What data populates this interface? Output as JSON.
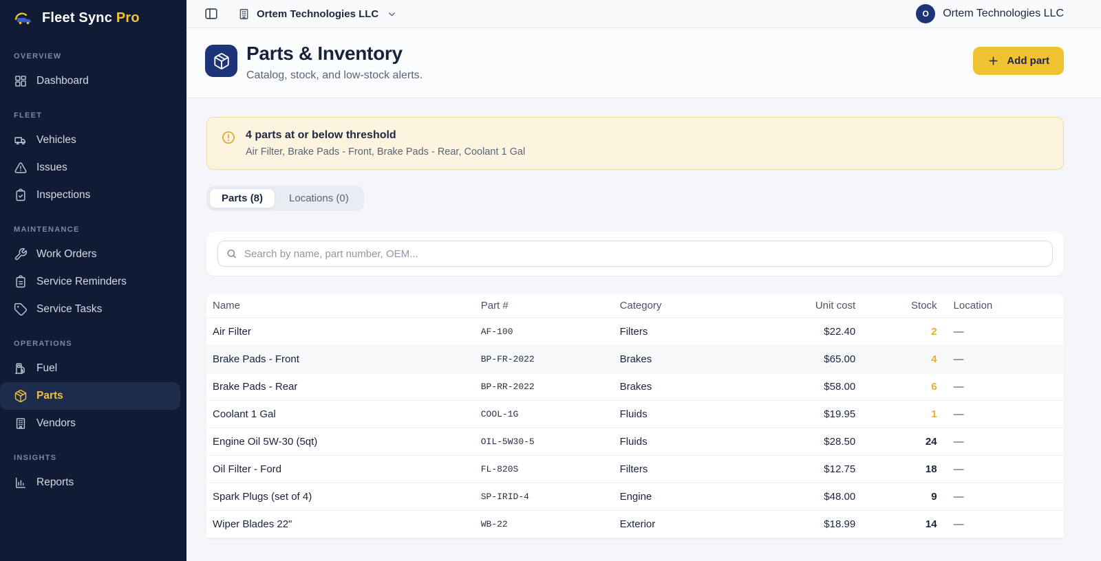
{
  "brand": {
    "name": "Fleet Sync",
    "suffix": "Pro"
  },
  "topbar": {
    "org_name": "Ortem Technologies LLC",
    "avatar_initial": "O",
    "account_name": "Ortem Technologies LLC"
  },
  "sidebar": {
    "sections": [
      {
        "label": "OVERVIEW",
        "items": [
          {
            "label": "Dashboard",
            "icon": "dashboard-icon",
            "active": false
          }
        ]
      },
      {
        "label": "FLEET",
        "items": [
          {
            "label": "Vehicles",
            "icon": "truck-icon",
            "active": false
          },
          {
            "label": "Issues",
            "icon": "warning-triangle-icon",
            "active": false
          },
          {
            "label": "Inspections",
            "icon": "clipboard-check-icon",
            "active": false
          }
        ]
      },
      {
        "label": "MAINTENANCE",
        "items": [
          {
            "label": "Work Orders",
            "icon": "wrench-icon",
            "active": false
          },
          {
            "label": "Service Reminders",
            "icon": "clipboard-list-icon",
            "active": false
          },
          {
            "label": "Service Tasks",
            "icon": "tag-icon",
            "active": false
          }
        ]
      },
      {
        "label": "OPERATIONS",
        "items": [
          {
            "label": "Fuel",
            "icon": "fuel-pump-icon",
            "active": false
          },
          {
            "label": "Parts",
            "icon": "package-icon",
            "active": true
          },
          {
            "label": "Vendors",
            "icon": "building-icon",
            "active": false
          }
        ]
      },
      {
        "label": "INSIGHTS",
        "items": [
          {
            "label": "Reports",
            "icon": "bar-chart-icon",
            "active": false
          }
        ]
      }
    ]
  },
  "page": {
    "title": "Parts & Inventory",
    "subtitle": "Catalog, stock, and low-stock alerts.",
    "add_button_label": "Add part",
    "icon": "package-icon"
  },
  "alert": {
    "icon": "alert-circle-icon",
    "title": "4 parts at or below threshold",
    "detail": "Air Filter, Brake Pads - Front, Brake Pads - Rear, Coolant 1 Gal"
  },
  "tabs": [
    {
      "label": "Parts (8)",
      "active": true
    },
    {
      "label": "Locations (0)",
      "active": false
    }
  ],
  "search": {
    "placeholder": "Search by name, part number, OEM...",
    "value": "",
    "icon": "search-icon"
  },
  "table": {
    "columns": [
      "Name",
      "Part #",
      "Category",
      "Unit cost",
      "Stock",
      "Location"
    ],
    "rows": [
      {
        "name": "Air Filter",
        "part_number": "AF-100",
        "category": "Filters",
        "unit_cost": "$22.40",
        "stock": "2",
        "low_stock": true,
        "location": "—",
        "highlight": false
      },
      {
        "name": "Brake Pads - Front",
        "part_number": "BP-FR-2022",
        "category": "Brakes",
        "unit_cost": "$65.00",
        "stock": "4",
        "low_stock": true,
        "location": "—",
        "highlight": true
      },
      {
        "name": "Brake Pads - Rear",
        "part_number": "BP-RR-2022",
        "category": "Brakes",
        "unit_cost": "$58.00",
        "stock": "6",
        "low_stock": true,
        "location": "—",
        "highlight": false
      },
      {
        "name": "Coolant 1 Gal",
        "part_number": "COOL-1G",
        "category": "Fluids",
        "unit_cost": "$19.95",
        "stock": "1",
        "low_stock": true,
        "location": "—",
        "highlight": false
      },
      {
        "name": "Engine Oil 5W-30 (5qt)",
        "part_number": "OIL-5W30-5",
        "category": "Fluids",
        "unit_cost": "$28.50",
        "stock": "24",
        "low_stock": false,
        "location": "—",
        "highlight": false
      },
      {
        "name": "Oil Filter - Ford",
        "part_number": "FL-820S",
        "category": "Filters",
        "unit_cost": "$12.75",
        "stock": "18",
        "low_stock": false,
        "location": "—",
        "highlight": false
      },
      {
        "name": "Spark Plugs (set of 4)",
        "part_number": "SP-IRID-4",
        "category": "Engine",
        "unit_cost": "$48.00",
        "stock": "9",
        "low_stock": false,
        "location": "—",
        "highlight": false
      },
      {
        "name": "Wiper Blades 22\"",
        "part_number": "WB-22",
        "category": "Exterior",
        "unit_cost": "$18.99",
        "stock": "14",
        "low_stock": false,
        "location": "—",
        "highlight": false
      }
    ]
  },
  "colors": {
    "accent_yellow": "#f0c232",
    "low_stock": "#edaa33",
    "sidebar_bg": "#101c36",
    "active_item_bg": "#1d2b4d",
    "brand_blue": "#1d3479",
    "alert_bg": "#fcf4de",
    "alert_border": "#f1d9a3"
  }
}
